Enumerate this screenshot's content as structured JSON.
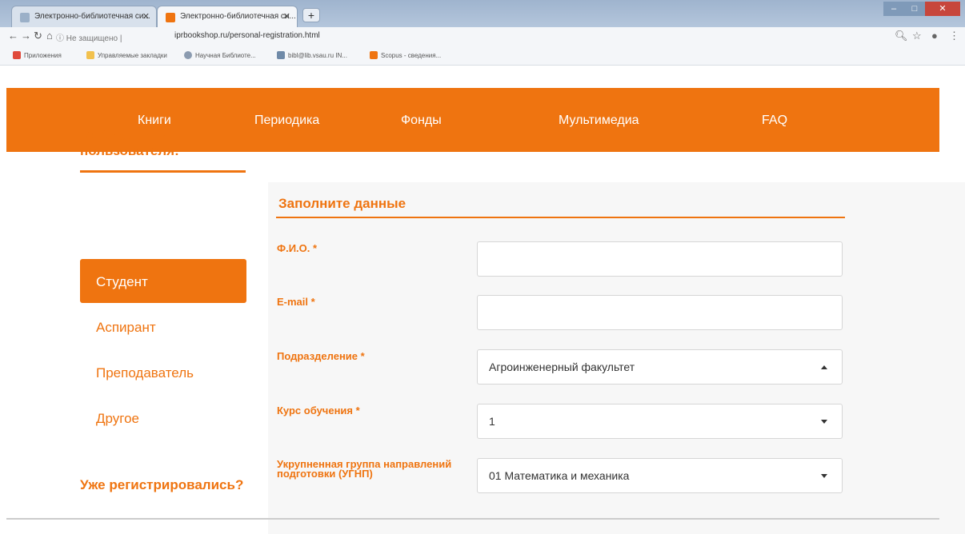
{
  "browser": {
    "tabs": [
      {
        "title": "Электронно-библиотечная си..."
      },
      {
        "title": "Электронно-библиотечная си..."
      }
    ],
    "new_tab_label": "+",
    "security_label": "Не защищено",
    "url": "iprbookshop.ru/personal-registration.html",
    "bookmarks": [
      {
        "label": "Приложения"
      },
      {
        "label": "Управляемые закладки"
      },
      {
        "label": "Научная Библиоте..."
      },
      {
        "label": "bibl@lib.vsau.ru IN..."
      },
      {
        "label": "Scopus - сведения..."
      }
    ],
    "colors": {
      "accent": "#ef7410"
    }
  },
  "nav": {
    "items": [
      {
        "label": "Книги"
      },
      {
        "label": "Периодика"
      },
      {
        "label": "Фонды"
      },
      {
        "label": "Мультимедиа"
      },
      {
        "label": "FAQ"
      }
    ]
  },
  "sidebar": {
    "title": "Выберите тип пользователя:",
    "items": [
      {
        "label": "Студент",
        "active": true
      },
      {
        "label": "Аспирант"
      },
      {
        "label": "Преподаватель"
      },
      {
        "label": "Другое"
      }
    ],
    "already_registered": "Уже регистрировались?"
  },
  "form": {
    "title": "Заполните данные",
    "fields": [
      {
        "label": "Ф.И.О. *",
        "value": ""
      },
      {
        "label": "E-mail *",
        "value": ""
      },
      {
        "label": "Подразделение *",
        "value": "Агроинженерный факультет"
      },
      {
        "label": "Курс обучения *",
        "value": "1"
      },
      {
        "label": "Укрупненная группа направлений подготовки (УГНП)",
        "value": "01 Математика и механика"
      }
    ]
  }
}
